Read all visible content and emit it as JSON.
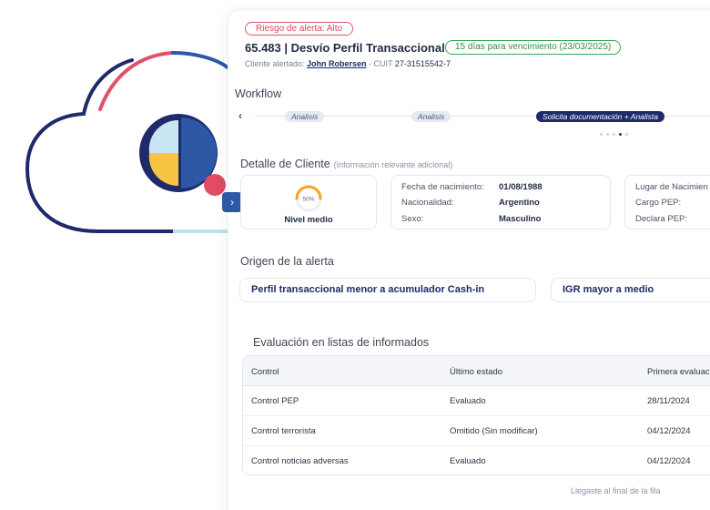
{
  "header": {
    "risk_badge": "Riesgo de alerta: Alto",
    "case_title": "65.483 | Desvío Perfil Transaccional",
    "expiry_badge": "15 días para vencimiento (23/03/2025)",
    "client_prefix": "Cliente alertado: ",
    "client_name": "John Robersen",
    "cuit_sep": " - CUIT ",
    "cuit": "27-31515542-7"
  },
  "workflow": {
    "title": "Workflow",
    "steps": [
      "Analisis",
      "Analisis",
      "Solicita documentación + Analista"
    ]
  },
  "client_detail": {
    "title": "Detalle de Cliente",
    "subtitle": "(Información relevante adicional)",
    "gauge_value": "50%",
    "gauge_fraction": 0.5,
    "level_label": "Nivel medio",
    "fields": [
      {
        "label": "Fecha de nacimiento:",
        "value": "01/08/1988"
      },
      {
        "label": "Nacionalidad:",
        "value": "Argentino"
      },
      {
        "label": "Sexo:",
        "value": "Masculino"
      }
    ],
    "extra_fields": [
      "Lugar de Nacimien",
      "Cargo PEP:",
      "Declara PEP:"
    ]
  },
  "origin": {
    "title": "Origen de la alerta",
    "items": [
      "Perfil transaccional menor a acumulador Cash-in",
      "IGR mayor a medio"
    ]
  },
  "evaluation": {
    "title": "Evaluación en listas de informados",
    "columns": [
      "Control",
      "Último estado",
      "Primera evaluac"
    ],
    "rows": [
      [
        "Control PEP",
        "Evaluado",
        "28/11/2024"
      ],
      [
        "Control terrorista",
        "Omitido (Sin modificar)",
        "04/12/2024"
      ],
      [
        "Control noticias adversas",
        "Evaluado",
        "04/12/2024"
      ]
    ],
    "end_note": "Llegaste al final de la fila"
  },
  "colors": {
    "brand_navy": "#1f2a6b",
    "brand_blue": "#2c58a6",
    "alert_red": "#e0526b",
    "success_green": "#36a852",
    "gauge_orange": "#f3a51d"
  }
}
